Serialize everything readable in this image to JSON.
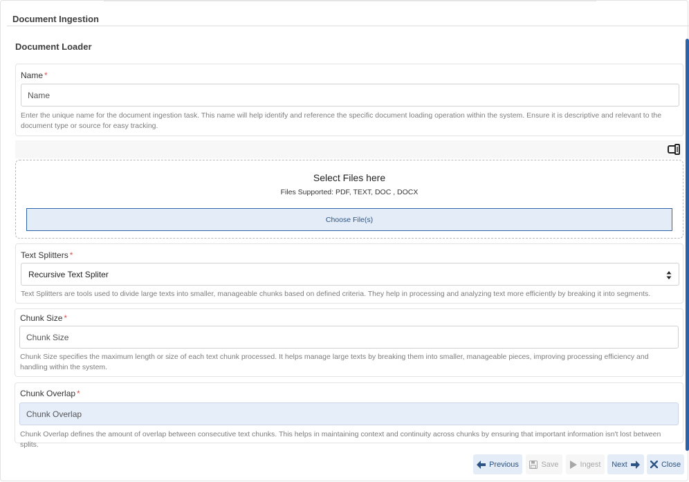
{
  "dialog": {
    "title": "Document Ingestion"
  },
  "section": {
    "title": "Document Loader"
  },
  "name_field": {
    "label": "Name",
    "required_mark": "*",
    "placeholder": "Name",
    "value": "",
    "help": "Enter the unique name for the document ingestion task. This name will help identify and reference the specific document loading operation within the system. Ensure it is descriptive and relevant to the document type or source for easy tracking."
  },
  "upload": {
    "title": "Select Files here",
    "supported": "Files Supported: PDF, TEXT, DOC , DOCX",
    "choose_label": "Choose File(s)",
    "dock_icon": "dock-panel-icon"
  },
  "splitter_field": {
    "label": "Text Splitters",
    "required_mark": "*",
    "selected": "Recursive Text Spliter",
    "help": "Text Splitters are tools used to divide large texts into smaller, manageable chunks based on defined criteria. They help in processing and analyzing text more efficiently by breaking it into segments."
  },
  "chunk_size_field": {
    "label": "Chunk Size",
    "required_mark": "*",
    "placeholder": "Chunk Size",
    "help": "Chunk Size specifies the maximum length or size of each text chunk processed. It helps manage large texts by breaking them into smaller, manageable pieces, improving processing efficiency and handling within the system."
  },
  "chunk_overlap_field": {
    "label": "Chunk Overlap",
    "required_mark": "*",
    "placeholder": "Chunk Overlap",
    "help": "Chunk Overlap defines the amount of overlap between consecutive text chunks. This helps in maintaining context and continuity across chunks by ensuring that important information isn't lost between splits."
  },
  "footer": {
    "previous_label": "Previous",
    "save_label": "Save",
    "ingest_label": "Ingest",
    "next_label": "Next",
    "close_label": "Close"
  },
  "colors": {
    "accent": "#2c63a8",
    "button_bg": "#e3ecf7",
    "required": "#d9534f",
    "disabled_text": "#a7a7a7"
  }
}
